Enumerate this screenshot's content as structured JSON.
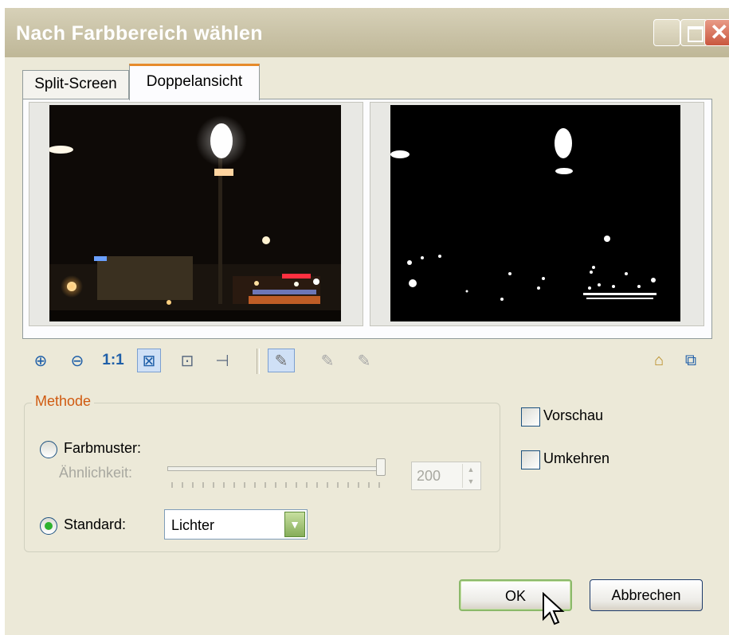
{
  "window": {
    "title": "Nach Farbbereich wählen",
    "title_color": "#ffffff"
  },
  "tabs": [
    {
      "label": "Split-Screen",
      "selected": false
    },
    {
      "label": "Doppelansicht",
      "selected": true
    }
  ],
  "toolbar": {
    "zoom_one_label": "1:1",
    "icons": [
      "zoom-in-icon",
      "zoom-out-icon",
      "actual-size-icon",
      "fit-window-icon",
      "zoom-region-icon",
      "pan-icon",
      "eyedropper-icon",
      "eyedropper-add-icon",
      "eyedropper-subtract-icon",
      "load-icon",
      "preview-window-icon"
    ]
  },
  "method": {
    "legend": "Methode",
    "farbmuster_label": "Farbmuster:",
    "farbmuster_selected": false,
    "similarity_label": "Ähnlichkeit:",
    "similarity_value": "200",
    "similarity_slider_fraction": 0.98,
    "standard_label": "Standard:",
    "standard_selected": true,
    "standard_value": "Lichter"
  },
  "options": {
    "vorschau_label": "Vorschau",
    "vorschau_checked": false,
    "umkehren_label": "Umkehren",
    "umkehren_checked": false
  },
  "buttons": {
    "ok_label": "OK",
    "cancel_label": "Abbrechen"
  },
  "colors": {
    "accent_tab": "#e68b2c",
    "legend": "#d05a10",
    "radio_dot": "#2eb22e"
  }
}
